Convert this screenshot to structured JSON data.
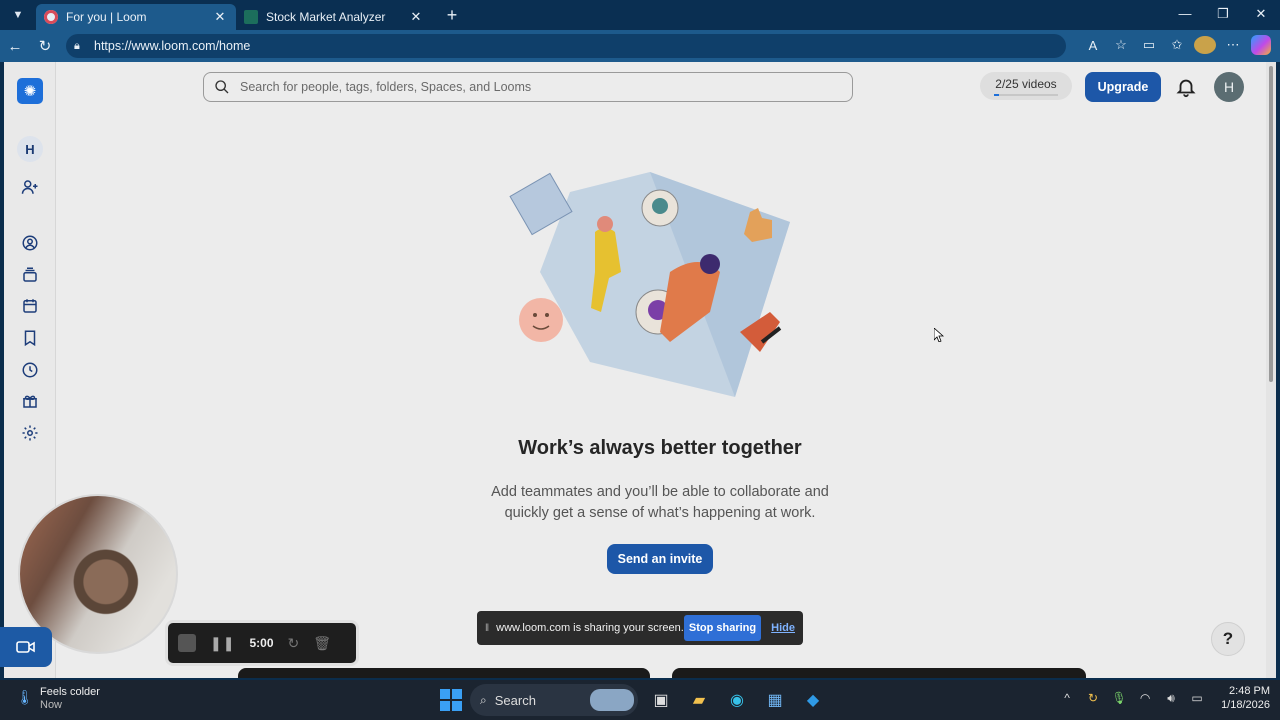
{
  "browser": {
    "tabs": [
      {
        "title": "For you | Loom",
        "active": true
      },
      {
        "title": "Stock Market Analyzer",
        "active": false
      }
    ],
    "url": "https://www.loom.com/home"
  },
  "search": {
    "placeholder": "Search for people, tags, folders, Spaces, and Looms"
  },
  "header": {
    "videos_count": "2/25 videos",
    "videos_fraction": 0.08,
    "upgrade_label": "Upgrade",
    "user_initial": "H"
  },
  "sidebar": {
    "workspace_initial": "H"
  },
  "main": {
    "headline": "Work’s always better together",
    "subtext_line1": "Add teammates and you’ll be able to collaborate and",
    "subtext_line2": "quickly get a sense of what’s happening at work.",
    "invite_label": "Send an invite"
  },
  "share_bar": {
    "message": "www.loom.com is sharing your screen.",
    "stop_label": "Stop sharing",
    "hide_label": "Hide"
  },
  "help_label": "?",
  "recorder": {
    "time": "5:00"
  },
  "taskbar": {
    "weather_title": "Feels colder",
    "weather_sub": "Now",
    "search_label": "Search",
    "time": "2:48 PM",
    "date": "1/18/2026"
  },
  "colors": {
    "accent": "#1d57a8",
    "tab_active": "#1d5a8c",
    "page_bg": "#ececec"
  }
}
